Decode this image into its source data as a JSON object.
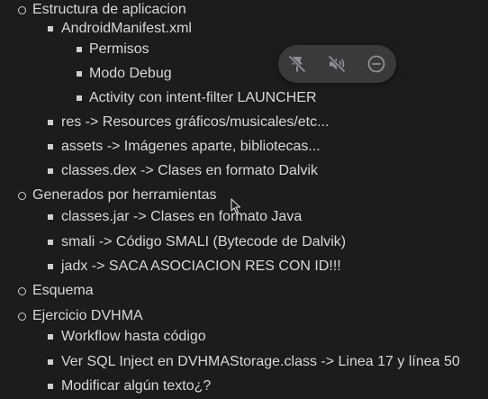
{
  "outline": {
    "items": [
      {
        "level": 1,
        "text": "Estructura de aplicacion"
      },
      {
        "level": 2,
        "text": "AndroidManifest.xml"
      },
      {
        "level": 3,
        "text": "Permisos"
      },
      {
        "level": 3,
        "text": "Modo Debug"
      },
      {
        "level": 3,
        "text": "Activity con intent-filter LAUNCHER"
      },
      {
        "level": 2,
        "text": "res -> Resources gráficos/musicales/etc..."
      },
      {
        "level": 2,
        "text": "assets -> Imágenes aparte, bibliotecas..."
      },
      {
        "level": 2,
        "text": "classes.dex -> Clases en formato Dalvik"
      },
      {
        "level": 1,
        "text": "Generados por herramientas"
      },
      {
        "level": 2,
        "text": "classes.jar -> Clases en formato Java"
      },
      {
        "level": 2,
        "text": "smali -> Código SMALI (Bytecode de Dalvik)"
      },
      {
        "level": 2,
        "text": "jadx -> SACA ASOCIACION RES CON ID!!!"
      },
      {
        "level": 1,
        "text": "Esquema"
      },
      {
        "level": 1,
        "text": "Ejercicio DVHMA"
      },
      {
        "level": 2,
        "text": "Workflow hasta código"
      },
      {
        "level": 2,
        "text": "Ver SQL Inject en DVHMAStorage.class -> Linea 17 y línea 50"
      },
      {
        "level": 2,
        "text": "Modificar algún texto¿?"
      }
    ]
  },
  "media_controls": {
    "icons": [
      "pin-off-icon",
      "speaker-muted-icon",
      "minus-circle-icon"
    ]
  },
  "colors": {
    "background": "#1c1c1e",
    "text": "#d7d7d7",
    "pill": "#3a3a3c",
    "icon": "#8e8e93"
  }
}
